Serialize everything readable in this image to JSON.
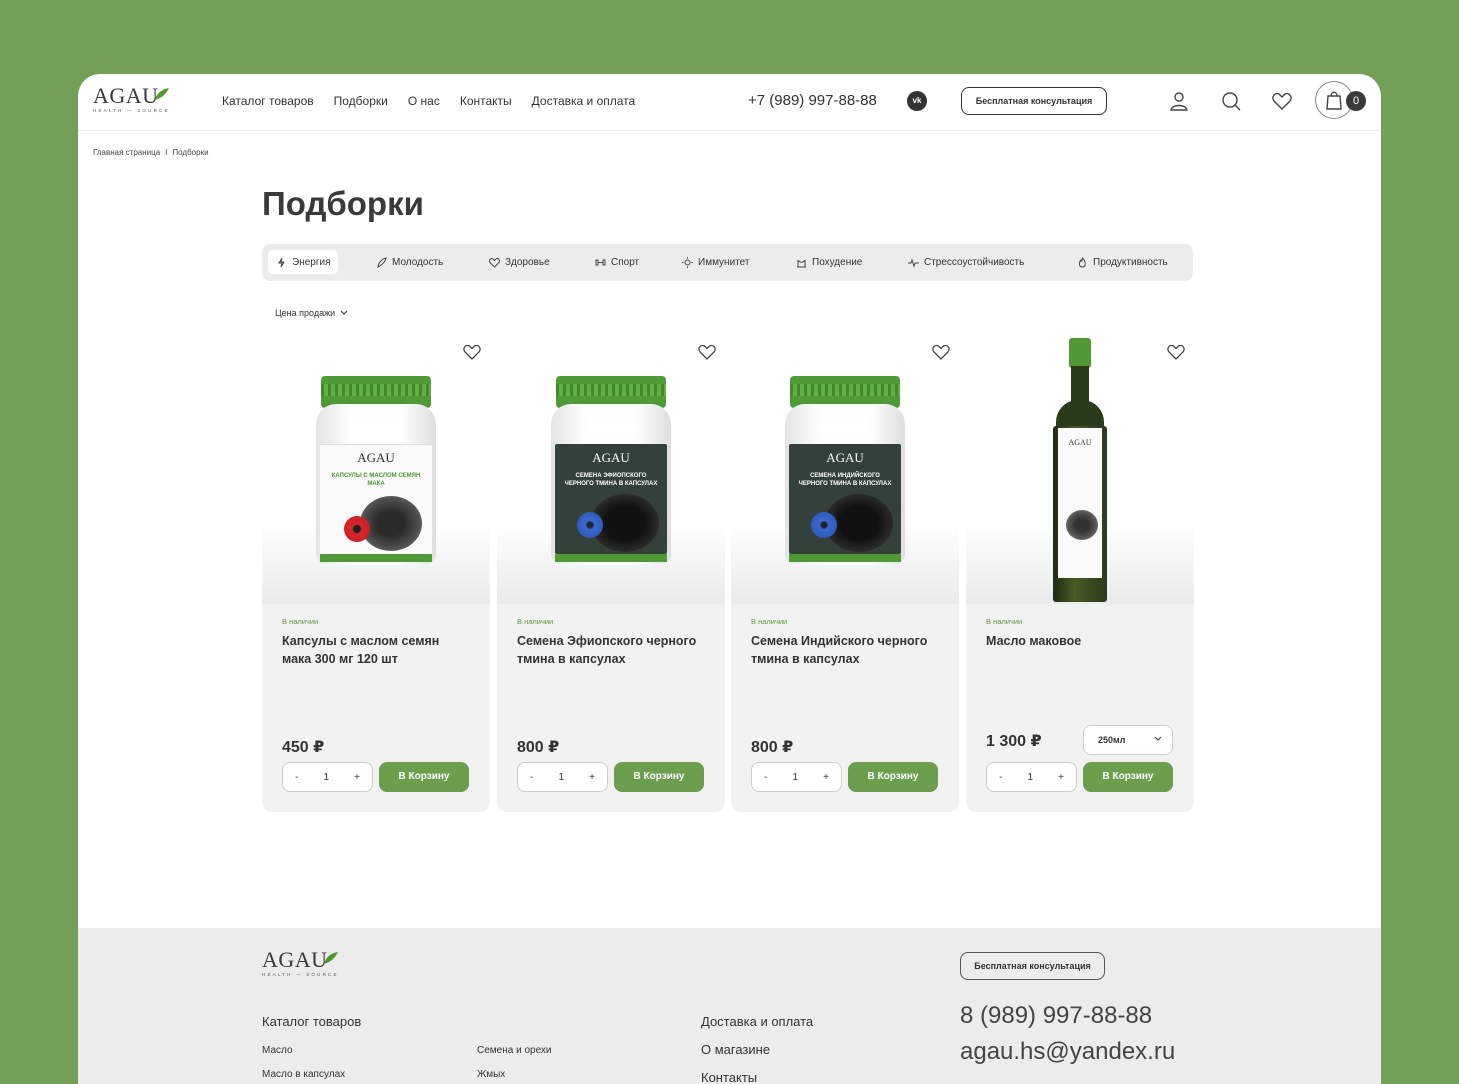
{
  "header": {
    "logo_text": "AGAU",
    "logo_sub": "HEALTH — SOURCE",
    "nav": [
      "Каталог товаров",
      "Подборки",
      "О нас",
      "Контакты",
      "Доставка и оплата"
    ],
    "phone": "+7 (989) 997-88-88",
    "vk_label": "vk",
    "consult_label": "Бесплатная консультация",
    "cart_count": "0"
  },
  "breadcrumbs": [
    "Главная страница",
    "Подборки"
  ],
  "breadcrumb_sep": "I",
  "page_title": "Подборки",
  "tabs": [
    "Энергия",
    "Молодость",
    "Здоровье",
    "Спорт",
    "Иммунитет",
    "Похудение",
    "Стрессоустойчивость",
    "Продуктивность"
  ],
  "active_tab": "Энергия",
  "sort_label": "Цена продажи",
  "products": [
    {
      "stock": "В наличии",
      "name": "Капсулы с маслом семян мака 300 мг 120 шт",
      "price": "450 ₽",
      "qty": "1",
      "buy_label": "В Корзину",
      "label_text": "КАПСУЛЫ С МАСЛОМ СЕМЯН МАКА",
      "label_style": "white"
    },
    {
      "stock": "В наличии",
      "name": "Семена Эфиопского черного тмина в капсулах",
      "price": "800 ₽",
      "qty": "1",
      "buy_label": "В Корзину",
      "label_text": "СЕМЕНА ЭФИОПСКОГО ЧЕРНОГО ТМИНА В КАПСУЛАХ",
      "label_style": "dark"
    },
    {
      "stock": "В наличии",
      "name": "Семена Индийского черного тмина в капсулах",
      "price": "800 ₽",
      "qty": "1",
      "buy_label": "В Корзину",
      "label_text": "СЕМЕНА ИНДИЙСКОГО ЧЕРНОГО ТМИНА В КАПСУЛАХ",
      "label_style": "dark"
    },
    {
      "stock": "В наличии",
      "name": "Масло маковое",
      "price": "1 300 ₽",
      "qty": "1",
      "buy_label": "В Корзину",
      "volume": "250мл",
      "label_text": "AGAU",
      "label_style": "bottle"
    }
  ],
  "qty_minus": "-",
  "qty_plus": "+",
  "footer": {
    "consult_label": "Бесплатная консультация",
    "catalog_head": "Каталог товаров",
    "catalog_links_col1": [
      "Масло",
      "Масло в капсулах"
    ],
    "catalog_links_col2": [
      "Семена и орехи",
      "Жмых"
    ],
    "links": [
      "Доставка и оплата",
      "О магазине",
      "Контакты"
    ],
    "phone": "8 (989) 997-88-88",
    "email": "agau.hs@yandex.ru"
  },
  "colors": {
    "background": "#739e55",
    "accent": "#6c9e4e",
    "stock_green": "#5a9a3a",
    "footer_bg": "#ececec"
  }
}
